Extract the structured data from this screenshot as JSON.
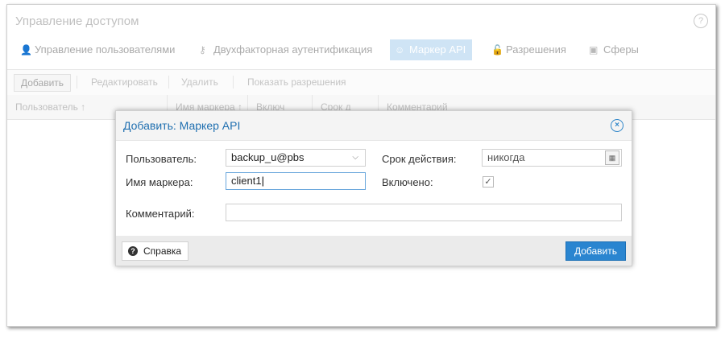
{
  "panel": {
    "title": "Управление доступом",
    "help_glyph": "?"
  },
  "tabs": [
    {
      "label": "Управление пользователями",
      "icon": "user-icon",
      "glyph": "👤"
    },
    {
      "label": "Двухфакторная аутентификация",
      "icon": "key-icon",
      "glyph": "⚷"
    },
    {
      "label": "Маркер API",
      "icon": "user-outline-icon",
      "glyph": "☺",
      "active": true
    },
    {
      "label": "Разрешения",
      "icon": "unlock-icon",
      "glyph": "🔓"
    },
    {
      "label": "Сферы",
      "icon": "address-book-icon",
      "glyph": "▣"
    }
  ],
  "toolbar": {
    "add": "Добавить",
    "edit": "Редактировать",
    "remove": "Удалить",
    "show_permissions": "Показать разрешения"
  },
  "grid": {
    "columns": [
      "Пользователь ↑",
      "Имя маркера ↑",
      "Включ",
      "Срок д",
      "Комментарий"
    ]
  },
  "dialog": {
    "title": "Добавить: Маркер API",
    "close_glyph": "×",
    "user_label": "Пользователь:",
    "user_value": "backup_u@pbs",
    "token_label": "Имя маркера:",
    "token_value": "client1",
    "expire_label": "Срок действия:",
    "expire_placeholder": "никогда",
    "enabled_label": "Включено:",
    "enabled": true,
    "check_glyph": "✓",
    "comment_label": "Комментарий:",
    "comment_value": "",
    "help_button": "Справка",
    "submit_button": "Добавить"
  },
  "colors": {
    "accent": "#2a85d0",
    "title_blue": "#1f6fb0",
    "active_tab_bg": "#cfe4f5"
  }
}
